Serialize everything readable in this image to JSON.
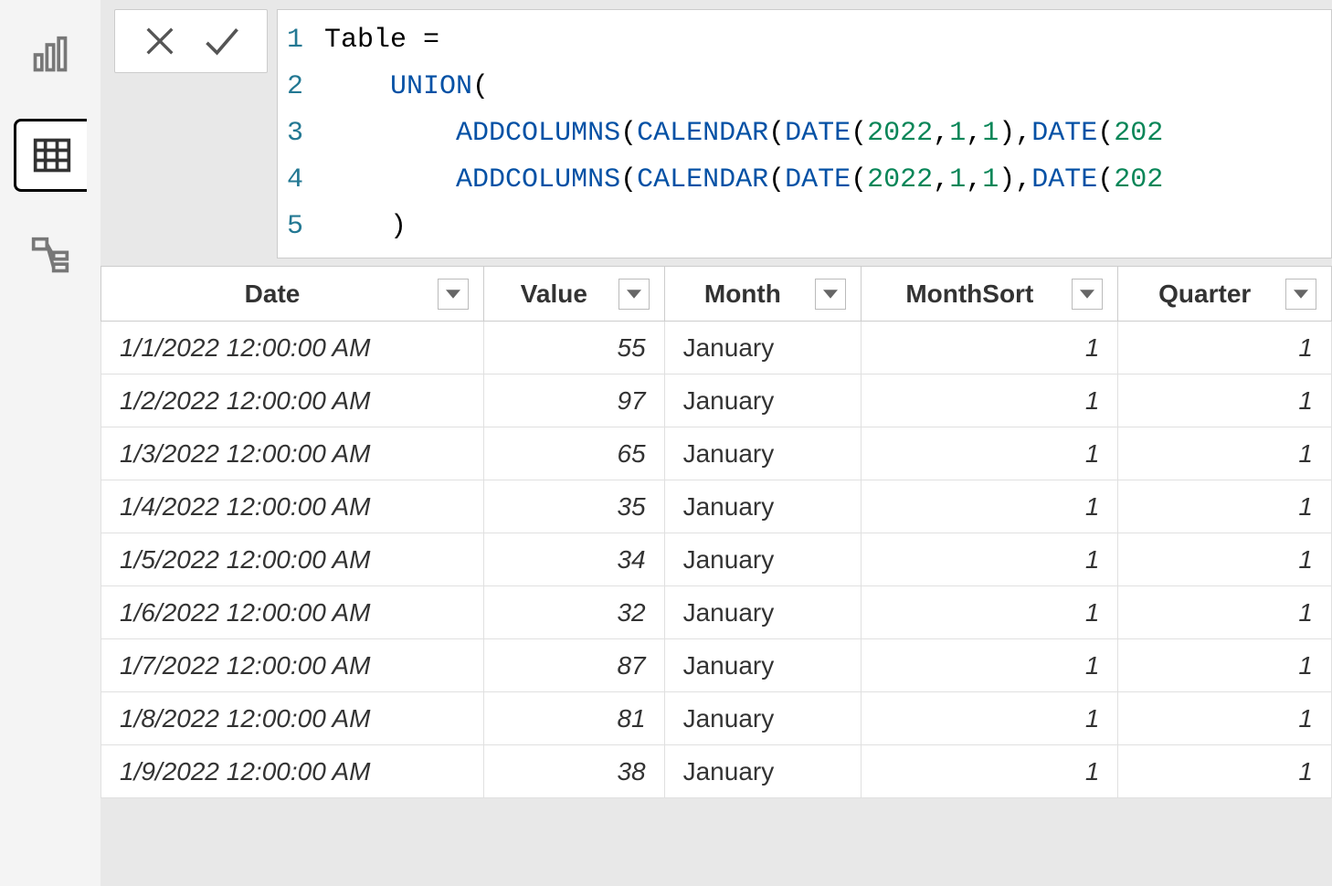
{
  "formula": {
    "lines": [
      {
        "num": "1",
        "indent": "",
        "tokens": [
          {
            "t": "ident",
            "v": "Table "
          },
          {
            "t": "punct",
            "v": "="
          }
        ]
      },
      {
        "num": "2",
        "indent": "    ",
        "tokens": [
          {
            "t": "kw-func",
            "v": "UNION"
          },
          {
            "t": "punct",
            "v": "("
          }
        ]
      },
      {
        "num": "3",
        "indent": "        ",
        "tokens": [
          {
            "t": "kw-func2",
            "v": "ADDCOLUMNS"
          },
          {
            "t": "punct",
            "v": "("
          },
          {
            "t": "kw-func2",
            "v": "CALENDAR"
          },
          {
            "t": "punct",
            "v": "("
          },
          {
            "t": "kw-func2",
            "v": "DATE"
          },
          {
            "t": "punct",
            "v": "("
          },
          {
            "t": "num",
            "v": "2022"
          },
          {
            "t": "punct",
            "v": ","
          },
          {
            "t": "num",
            "v": "1"
          },
          {
            "t": "punct",
            "v": ","
          },
          {
            "t": "num",
            "v": "1"
          },
          {
            "t": "punct",
            "v": "),"
          },
          {
            "t": "kw-func2",
            "v": "DATE"
          },
          {
            "t": "punct",
            "v": "("
          },
          {
            "t": "num",
            "v": "202"
          }
        ]
      },
      {
        "num": "4",
        "indent": "        ",
        "tokens": [
          {
            "t": "kw-func2",
            "v": "ADDCOLUMNS"
          },
          {
            "t": "punct",
            "v": "("
          },
          {
            "t": "kw-func2",
            "v": "CALENDAR"
          },
          {
            "t": "punct",
            "v": "("
          },
          {
            "t": "kw-func2",
            "v": "DATE"
          },
          {
            "t": "punct",
            "v": "("
          },
          {
            "t": "num",
            "v": "2022"
          },
          {
            "t": "punct",
            "v": ","
          },
          {
            "t": "num",
            "v": "1"
          },
          {
            "t": "punct",
            "v": ","
          },
          {
            "t": "num",
            "v": "1"
          },
          {
            "t": "punct",
            "v": "),"
          },
          {
            "t": "kw-func2",
            "v": "DATE"
          },
          {
            "t": "punct",
            "v": "("
          },
          {
            "t": "num",
            "v": "202"
          }
        ]
      },
      {
        "num": "5",
        "indent": "    ",
        "tokens": [
          {
            "t": "punct",
            "v": ")"
          }
        ]
      }
    ]
  },
  "table": {
    "columns": [
      {
        "label": "Date",
        "class": "col-date"
      },
      {
        "label": "Value",
        "class": "col-value"
      },
      {
        "label": "Month",
        "class": "col-month"
      },
      {
        "label": "MonthSort",
        "class": "col-monthsort"
      },
      {
        "label": "Quarter",
        "class": "col-quarter"
      }
    ],
    "rows": [
      {
        "date": "1/1/2022 12:00:00 AM",
        "value": "55",
        "month": "January",
        "monthsort": "1",
        "quarter": "1"
      },
      {
        "date": "1/2/2022 12:00:00 AM",
        "value": "97",
        "month": "January",
        "monthsort": "1",
        "quarter": "1"
      },
      {
        "date": "1/3/2022 12:00:00 AM",
        "value": "65",
        "month": "January",
        "monthsort": "1",
        "quarter": "1"
      },
      {
        "date": "1/4/2022 12:00:00 AM",
        "value": "35",
        "month": "January",
        "monthsort": "1",
        "quarter": "1"
      },
      {
        "date": "1/5/2022 12:00:00 AM",
        "value": "34",
        "month": "January",
        "monthsort": "1",
        "quarter": "1"
      },
      {
        "date": "1/6/2022 12:00:00 AM",
        "value": "32",
        "month": "January",
        "monthsort": "1",
        "quarter": "1"
      },
      {
        "date": "1/7/2022 12:00:00 AM",
        "value": "87",
        "month": "January",
        "monthsort": "1",
        "quarter": "1"
      },
      {
        "date": "1/8/2022 12:00:00 AM",
        "value": "81",
        "month": "January",
        "monthsort": "1",
        "quarter": "1"
      },
      {
        "date": "1/9/2022 12:00:00 AM",
        "value": "38",
        "month": "January",
        "monthsort": "1",
        "quarter": "1"
      }
    ]
  }
}
